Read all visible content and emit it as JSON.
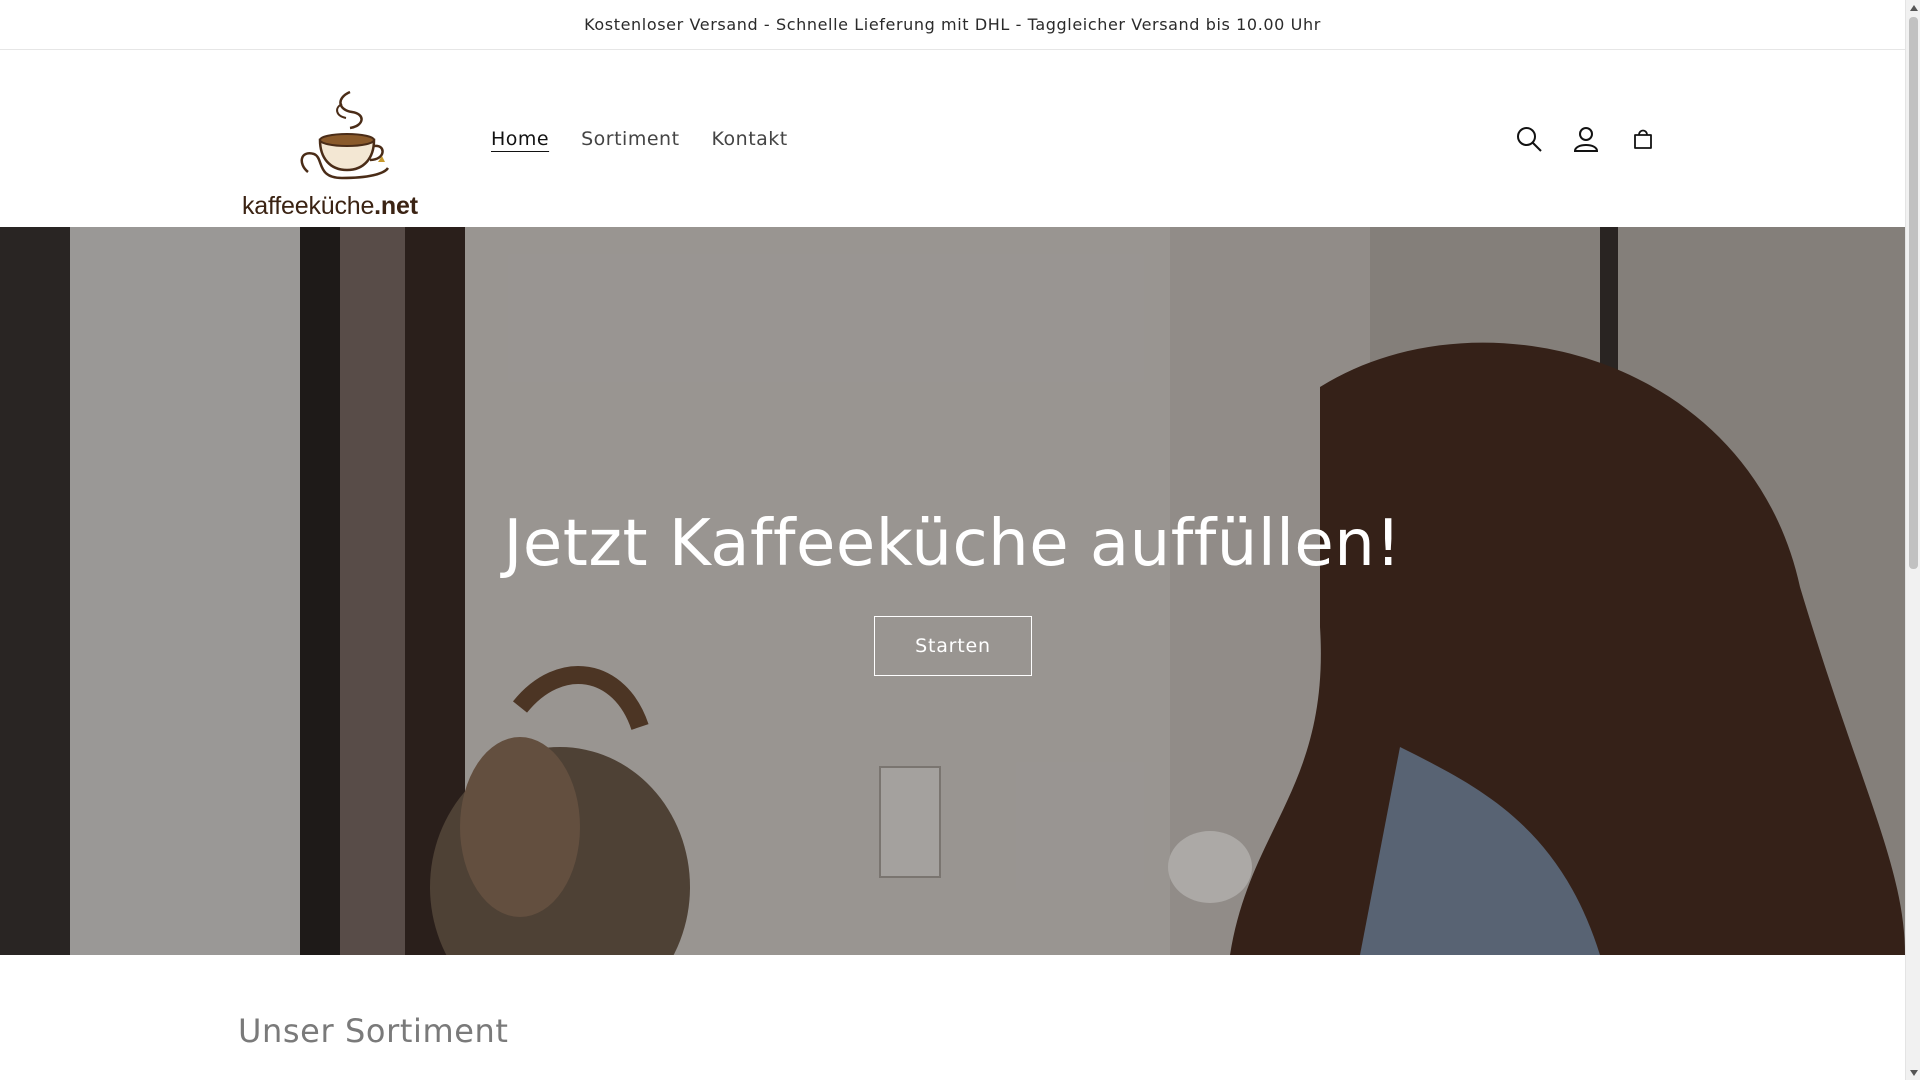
{
  "announcement": {
    "text": "Kostenloser Versand - Schnelle Lieferung mit DHL - Taggleicher Versand bis 10.00 Uhr"
  },
  "header": {
    "logo": {
      "name": "kaffeeküche",
      "suffix": ".net",
      "icon": "coffee-cup-icon"
    },
    "nav": [
      {
        "label": "Home",
        "active": true
      },
      {
        "label": "Sortiment",
        "active": false
      },
      {
        "label": "Kontakt",
        "active": false
      }
    ],
    "icons": [
      "search-icon",
      "account-icon",
      "cart-icon"
    ]
  },
  "hero": {
    "title": "Jetzt Kaffeeküche auffüllen!",
    "button_label": "Starten"
  },
  "section": {
    "title": "Unser Sortiment"
  },
  "colors": {
    "text": "#121212",
    "hero_text": "#ffffff",
    "logo_brown": "#3b2313",
    "muted_heading": "#7a7a7a"
  }
}
